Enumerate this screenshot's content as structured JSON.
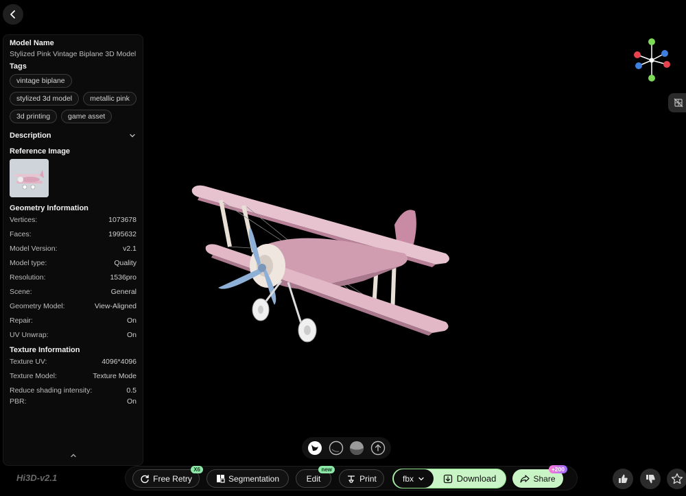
{
  "panel": {
    "model_name_label": "Model Name",
    "model_name": "Stylized Pink Vintage Biplane 3D Model",
    "tags_label": "Tags",
    "tags": [
      "vintage biplane",
      "stylized 3d model",
      "metallic pink",
      "3d printing",
      "game asset"
    ],
    "description_label": "Description",
    "reference_label": "Reference Image",
    "geometry_label": "Geometry Information",
    "geometry": [
      {
        "k": "Vertices:",
        "v": "1073678"
      },
      {
        "k": "Faces:",
        "v": "1995632"
      },
      {
        "k": "Model Version:",
        "v": "v2.1"
      },
      {
        "k": "Model type:",
        "v": "Quality"
      },
      {
        "k": "Resolution:",
        "v": "1536pro"
      },
      {
        "k": "Scene:",
        "v": "General"
      },
      {
        "k": "Geometry Model:",
        "v": "View-Aligned"
      },
      {
        "k": "Repair:",
        "v": "On"
      },
      {
        "k": "UV Unwrap:",
        "v": "On"
      }
    ],
    "texture_label": "Texture Information",
    "texture": [
      {
        "k": "Texture UV:",
        "v": "4096*4096"
      },
      {
        "k": "Texture Model:",
        "v": "Texture Mode"
      },
      {
        "k": "Reduce shading intensity:",
        "v": "0.5"
      },
      {
        "k": "PBR:",
        "v": "On"
      }
    ]
  },
  "brand": "Hi3D-v2.1",
  "toolbar": {
    "retry_label": "Free Retry",
    "retry_badge": "X6",
    "segmentation_label": "Segmentation",
    "edit_label": "Edit",
    "edit_badge": "new",
    "print_label": "Print",
    "format_value": "fbx",
    "download_label": "Download",
    "share_label": "Share",
    "share_badge": "+200"
  },
  "colors": {
    "accent_green": "#c9f5c6",
    "badge_green": "#8de8a8",
    "plane_pink": "#d9a3b8",
    "propeller_blue": "#8fb0d6"
  }
}
